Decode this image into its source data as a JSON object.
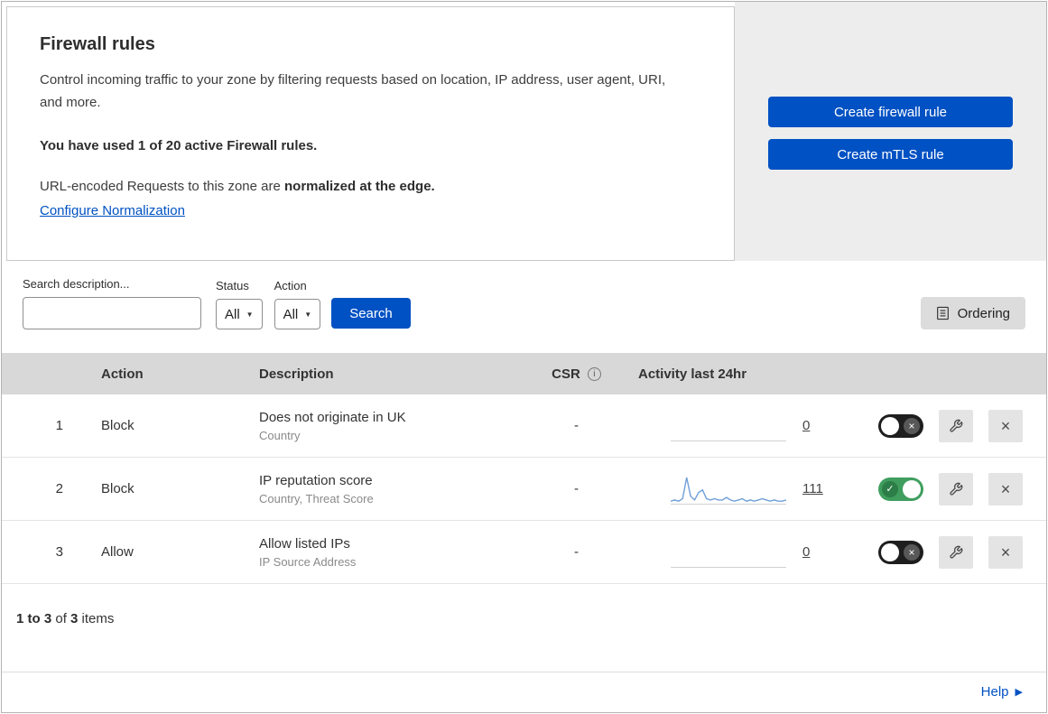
{
  "header": {
    "title": "Firewall rules",
    "description": "Control incoming traffic to your zone by filtering requests based on location, IP address, user agent, URI, and more.",
    "usage": "You have used 1 of 20 active Firewall rules.",
    "norm_prefix": "URL-encoded Requests to this zone are ",
    "norm_bold": "normalized at the edge.",
    "norm_link": "Configure Normalization",
    "btn_firewall": "Create firewall rule",
    "btn_mtls": "Create mTLS rule"
  },
  "filters": {
    "search_label": "Search description...",
    "status_label": "Status",
    "status_value": "All",
    "action_label": "Action",
    "action_value": "All",
    "search_button": "Search",
    "ordering_button": "Ordering"
  },
  "table": {
    "headers": {
      "action": "Action",
      "description": "Description",
      "csr": "CSR",
      "activity": "Activity last 24hr"
    },
    "rows": [
      {
        "index": "1",
        "action": "Block",
        "description": "Does not originate in UK",
        "fields": "Country",
        "csr": "-",
        "activity_count": "0",
        "enabled": false
      },
      {
        "index": "2",
        "action": "Block",
        "description": "IP reputation score",
        "fields": "Country, Threat Score",
        "csr": "-",
        "activity_count": "111",
        "enabled": true
      },
      {
        "index": "3",
        "action": "Allow",
        "description": "Allow listed IPs",
        "fields": "IP Source Address",
        "csr": "-",
        "activity_count": "0",
        "enabled": false
      }
    ]
  },
  "chart_data": [
    {
      "type": "line",
      "name": "rule-1-activity-sparkline",
      "title": "Activity last 24hr",
      "total": 0,
      "values": [
        0,
        0,
        0,
        0,
        0,
        0,
        0,
        0,
        0,
        0,
        0,
        0,
        0,
        0,
        0,
        0,
        0,
        0,
        0,
        0,
        0,
        0,
        0,
        0
      ]
    },
    {
      "type": "line",
      "name": "rule-2-activity-sparkline",
      "title": "Activity last 24hr",
      "total": 111,
      "values": [
        2,
        3,
        2,
        4,
        21,
        6,
        3,
        9,
        11,
        4,
        3,
        4,
        3,
        3,
        5,
        3,
        2,
        3,
        4,
        2,
        3,
        2,
        3,
        4,
        3,
        2,
        3,
        2,
        2,
        3
      ]
    },
    {
      "type": "line",
      "name": "rule-3-activity-sparkline",
      "title": "Activity last 24hr",
      "total": 0,
      "values": [
        0,
        0,
        0,
        0,
        0,
        0,
        0,
        0,
        0,
        0,
        0,
        0,
        0,
        0,
        0,
        0,
        0,
        0,
        0,
        0,
        0,
        0,
        0,
        0
      ]
    }
  ],
  "footer": {
    "range": "1 to 3",
    "of": " of ",
    "total": "3",
    "items": " items",
    "help": "Help"
  },
  "icons": {
    "caret_down": "▼",
    "check": "✓",
    "cross": "×",
    "info": "i",
    "help_arrow": "▶"
  },
  "colors": {
    "accent_blue": "#0051c3",
    "toggle_on_green": "#3f9e5e",
    "toggle_off_black": "#1e1e1e",
    "sparkline_blue": "#6f9fd8",
    "table_header_gray": "#d8d8d8",
    "panel_gray": "#ededed"
  }
}
